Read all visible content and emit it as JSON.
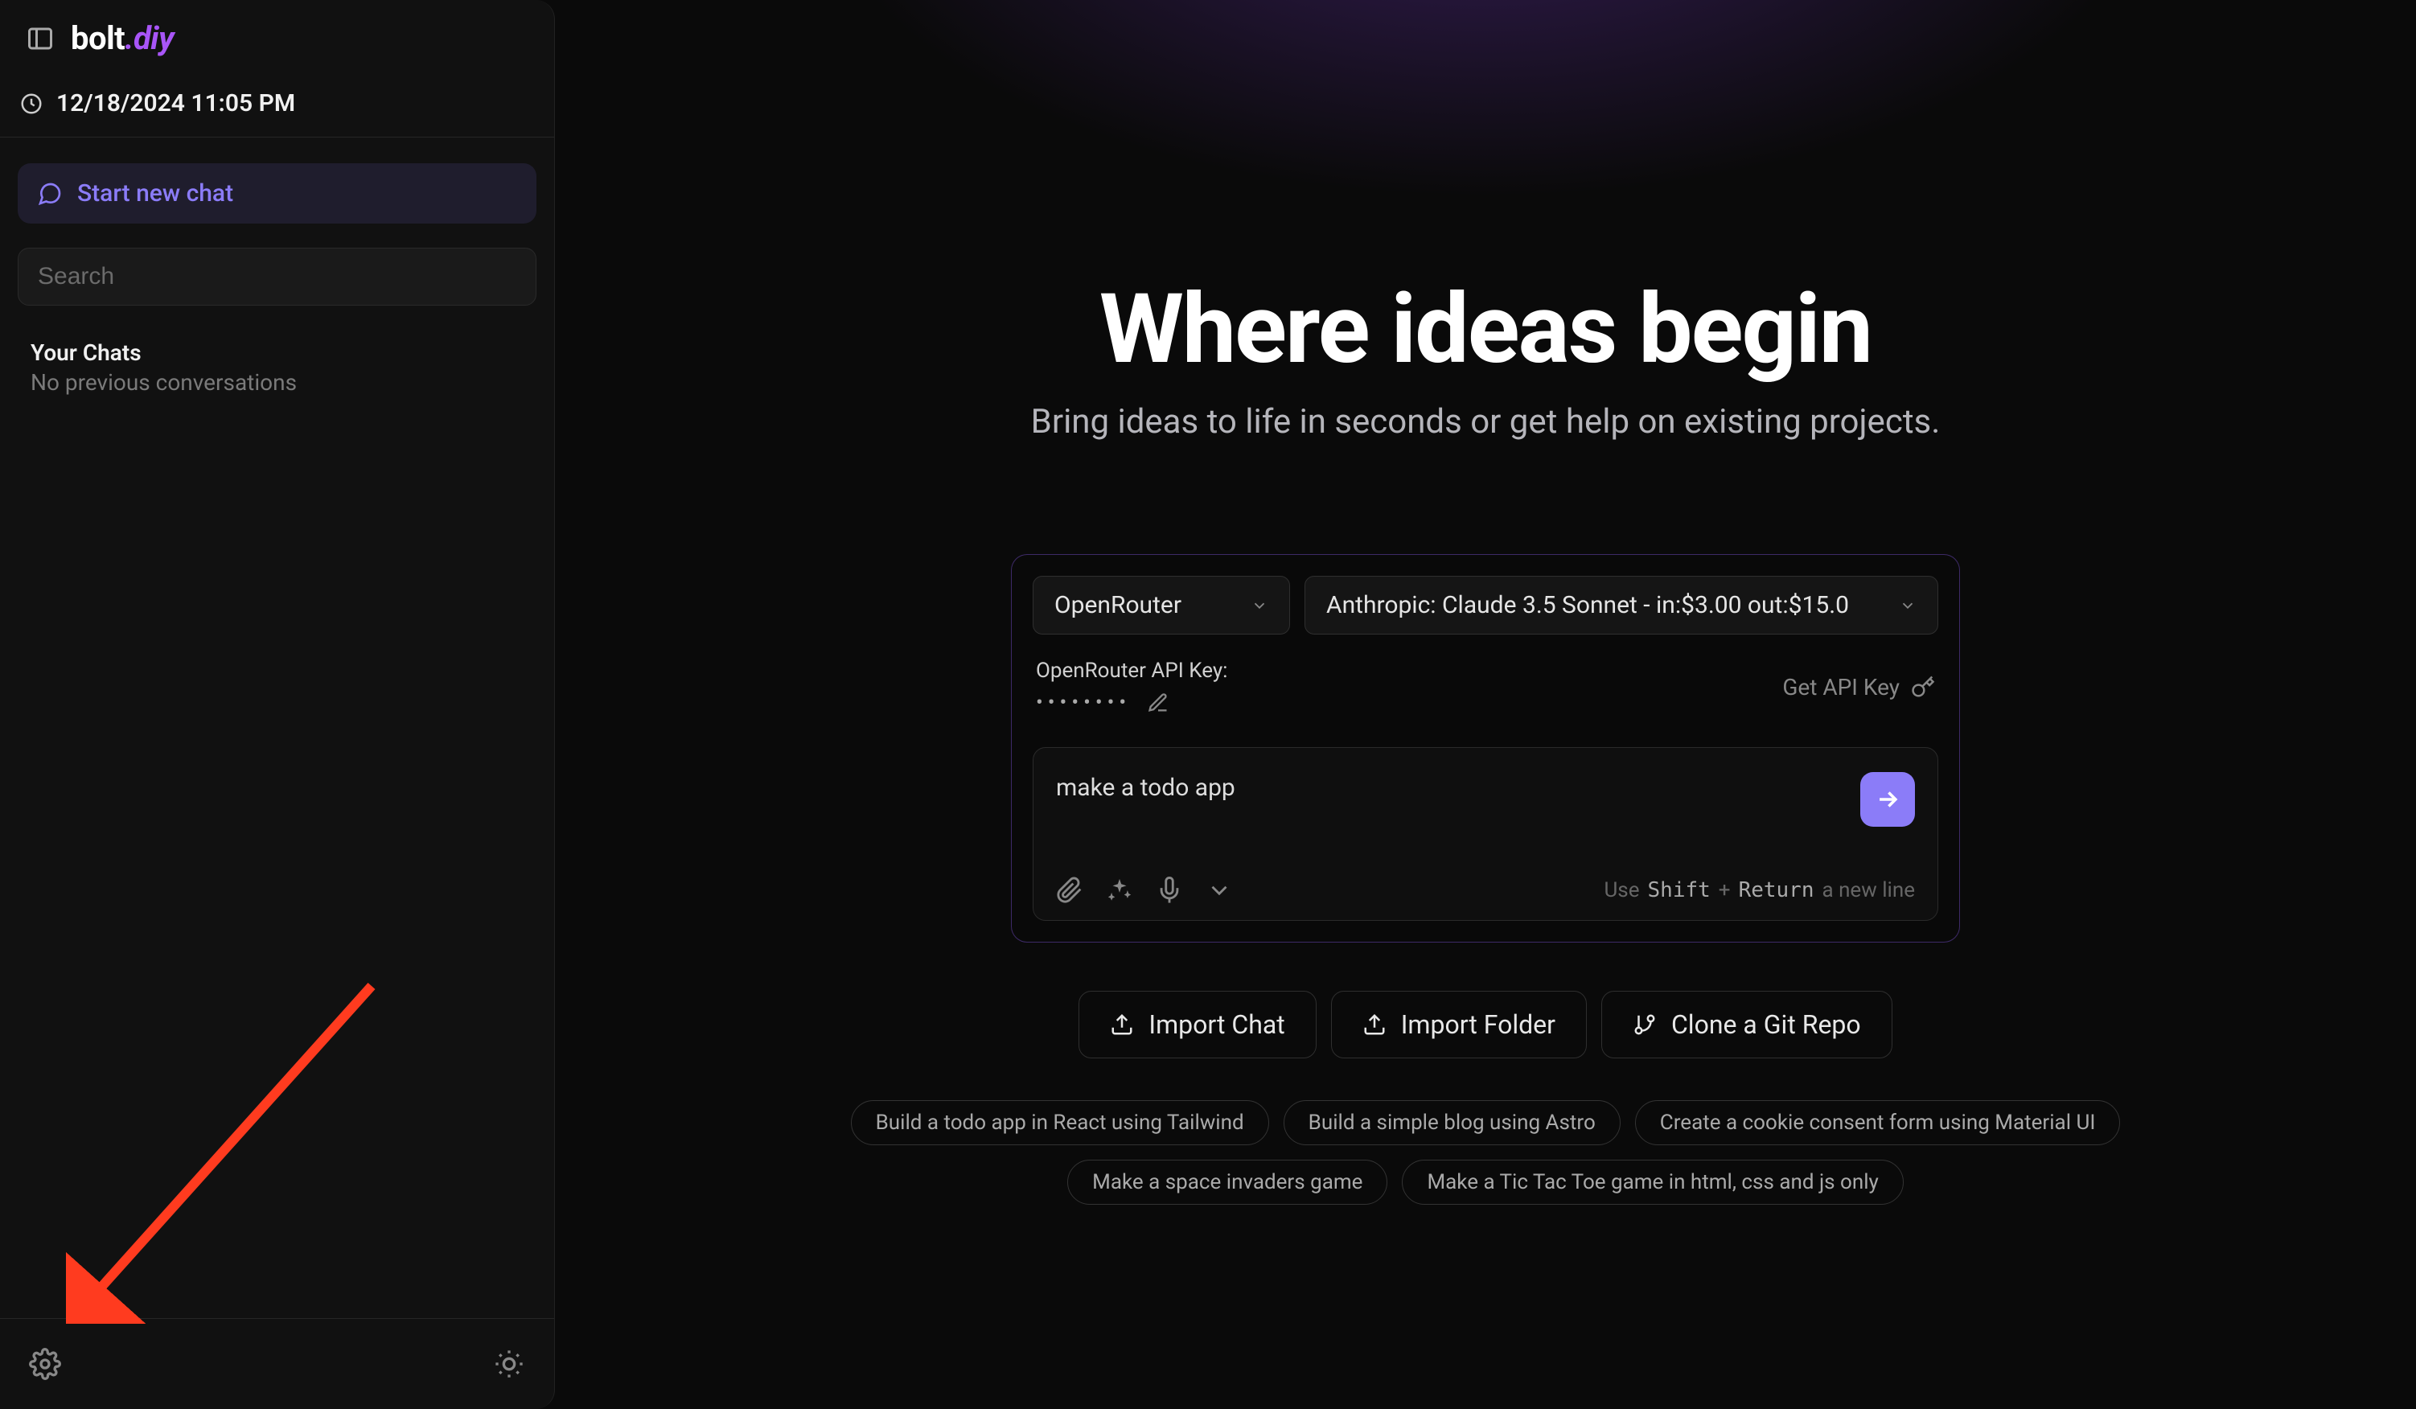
{
  "logo": {
    "part1": "bolt",
    "part2": ".diy"
  },
  "timestamp": "12/18/2024 11:05 PM",
  "sidebar": {
    "new_chat_label": "Start new chat",
    "search_placeholder": "Search",
    "chats_heading": "Your Chats",
    "no_convos": "No previous conversations"
  },
  "hero": {
    "title": "Where ideas begin",
    "subtitle": "Bring ideas to life in seconds or get help on existing projects."
  },
  "prompt_panel": {
    "provider": "OpenRouter",
    "model": "Anthropic: Claude 3.5 Sonnet - in:$3.00 out:$15.0",
    "api_key_label": "OpenRouter API Key:",
    "api_key_masked": "••••••••",
    "get_key_label": "Get API Key",
    "prompt_text": "make a todo app",
    "hint_use": "Use",
    "hint_shift": "Shift",
    "hint_plus": "+",
    "hint_return": "Return",
    "hint_tail": "a new line"
  },
  "actions": {
    "import_chat": "Import Chat",
    "import_folder": "Import Folder",
    "clone_repo": "Clone a Git Repo"
  },
  "suggestions": [
    "Build a todo app in React using Tailwind",
    "Build a simple blog using Astro",
    "Create a cookie consent form using Material UI",
    "Make a space invaders game",
    "Make a Tic Tac Toe game in html, css and js only"
  ]
}
